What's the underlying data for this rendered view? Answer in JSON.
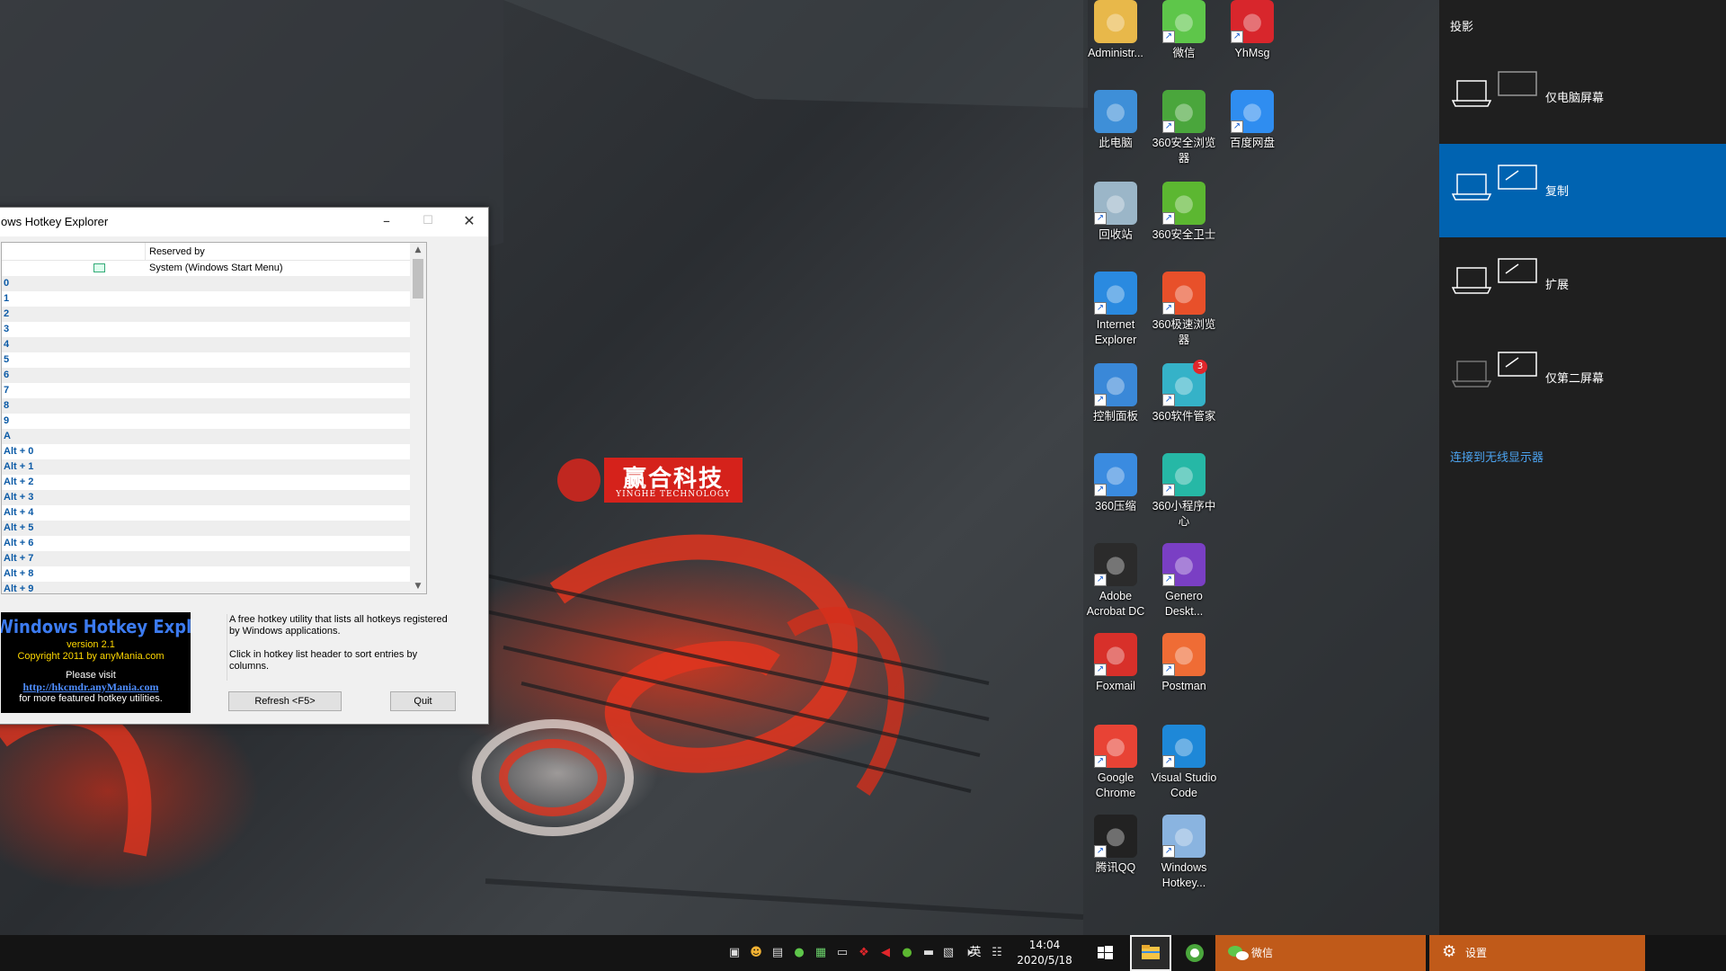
{
  "hotkey_window": {
    "title": "Windows Hotkey Explorer",
    "title_visible": "ows Hotkey Explorer",
    "columns": {
      "hotkey": "",
      "reserved_by": "Reserved by"
    },
    "rows": [
      {
        "key": "",
        "reserved_by": "System (Windows Start Menu)"
      },
      {
        "key": "0",
        "reserved_by": ""
      },
      {
        "key": "1",
        "reserved_by": ""
      },
      {
        "key": "2",
        "reserved_by": ""
      },
      {
        "key": "3",
        "reserved_by": ""
      },
      {
        "key": "4",
        "reserved_by": ""
      },
      {
        "key": "5",
        "reserved_by": ""
      },
      {
        "key": "6",
        "reserved_by": ""
      },
      {
        "key": "7",
        "reserved_by": ""
      },
      {
        "key": "8",
        "reserved_by": ""
      },
      {
        "key": "9",
        "reserved_by": ""
      },
      {
        "key": "A",
        "reserved_by": ""
      },
      {
        "key": "Alt + 0",
        "reserved_by": ""
      },
      {
        "key": "Alt + 1",
        "reserved_by": ""
      },
      {
        "key": "Alt + 2",
        "reserved_by": ""
      },
      {
        "key": "Alt + 3",
        "reserved_by": ""
      },
      {
        "key": "Alt + 4",
        "reserved_by": ""
      },
      {
        "key": "Alt + 5",
        "reserved_by": ""
      },
      {
        "key": "Alt + 6",
        "reserved_by": ""
      },
      {
        "key": "Alt + 7",
        "reserved_by": ""
      },
      {
        "key": "Alt + 8",
        "reserved_by": ""
      },
      {
        "key": "Alt + 9",
        "reserved_by": ""
      }
    ],
    "banner": {
      "title": "Windows Hotkey Explorer",
      "version": "version 2.1",
      "copyright": "Copyright 2011 by anyMania.com",
      "visit": "Please visit",
      "link": "http://hkcmdr.anyMania.com",
      "more": "for more featured hotkey utilities."
    },
    "info": {
      "line1": "A free hotkey utility that lists all hotkeys registered by Windows applications.",
      "line2": "Click in hotkey list header to sort entries by columns."
    },
    "refresh_label": "Refresh <F5>",
    "quit_label": "Quit"
  },
  "wallpaper": {
    "brand_zh": "赢合科技",
    "brand_en": "YINGHE TECHNOLOGY"
  },
  "desktop_icons": [
    {
      "label": "Administr...",
      "icon": "user-folder-icon",
      "color": "#e8b84a"
    },
    {
      "label": "微信",
      "icon": "wechat-icon",
      "color": "#5ec64a"
    },
    {
      "label": "YhMsg",
      "icon": "yhmsg-icon",
      "color": "#d8262c"
    },
    {
      "label": "此电脑",
      "icon": "this-pc-icon",
      "color": "#3e8fd8"
    },
    {
      "label": "360安全浏览器",
      "icon": "360-browser-icon",
      "color": "#4aa63c"
    },
    {
      "label": "百度网盘",
      "icon": "baidu-netdisk-icon",
      "color": "#2f8df0"
    },
    {
      "label": "回收站",
      "icon": "recycle-bin-icon",
      "color": "#9bb6c8"
    },
    {
      "label": "360安全卫士",
      "icon": "360-safe-icon",
      "color": "#5cb731"
    },
    {
      "label": "Internet Explorer",
      "icon": "internet-explorer-icon",
      "color": "#2a8ae0"
    },
    {
      "label": "360极速浏览器",
      "icon": "360-chrome-icon",
      "color": "#e8502a"
    },
    {
      "label": "控制面板",
      "icon": "control-panel-icon",
      "color": "#3a88d8"
    },
    {
      "label": "360软件管家",
      "icon": "360-software-icon",
      "color": "#35b2c8",
      "badge": "3"
    },
    {
      "label": "360压缩",
      "icon": "360-zip-icon",
      "color": "#3a8be0"
    },
    {
      "label": "360小程序中心",
      "icon": "360-miniapp-icon",
      "color": "#26b8a6"
    },
    {
      "label": "Adobe Acrobat DC",
      "icon": "acrobat-icon",
      "color": "#2b2b2b"
    },
    {
      "label": "Genero Deskt...",
      "icon": "genero-icon",
      "color": "#7a3fc4"
    },
    {
      "label": "Foxmail",
      "icon": "foxmail-icon",
      "color": "#d8302a"
    },
    {
      "label": "Postman",
      "icon": "postman-icon",
      "color": "#ef6c35"
    },
    {
      "label": "Google Chrome",
      "icon": "chrome-icon",
      "color": "#e84335"
    },
    {
      "label": "Visual Studio Code",
      "icon": "vscode-icon",
      "color": "#1e88d8"
    },
    {
      "label": "腾讯QQ",
      "icon": "qq-icon",
      "color": "#222222"
    },
    {
      "label": "Windows Hotkey...",
      "icon": "hotkey-explorer-icon",
      "color": "#8ab4e0"
    }
  ],
  "projection": {
    "title": "投影",
    "options": [
      {
        "label": "仅电脑屏幕",
        "icon": "pc-screen-only-icon",
        "selected": false
      },
      {
        "label": "复制",
        "icon": "duplicate-icon",
        "selected": true
      },
      {
        "label": "扩展",
        "icon": "extend-icon",
        "selected": false
      },
      {
        "label": "仅第二屏幕",
        "icon": "second-screen-only-icon",
        "selected": false
      }
    ],
    "wireless_link": "连接到无线显示器"
  },
  "taskbar": {
    "time": "14:04",
    "date": "2020/5/18",
    "ime": "英",
    "apps": [
      {
        "label": "",
        "icon": "file-explorer-icon"
      },
      {
        "label": "",
        "icon": "360-browser-icon"
      },
      {
        "label": "微信",
        "icon": "wechat-icon"
      },
      {
        "label": "设置",
        "icon": "settings-gear-icon"
      }
    ]
  },
  "colors": {
    "accent": "#0063b1",
    "taskbar_highlight": "#c05a19",
    "link_blue": "#4ca3ef"
  }
}
